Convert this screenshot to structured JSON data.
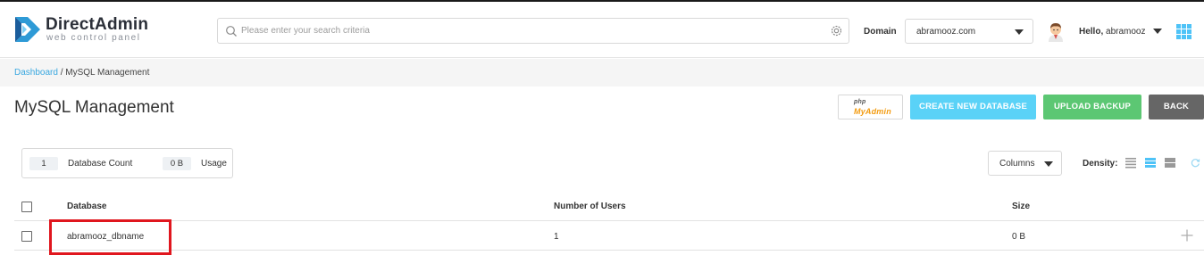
{
  "app": {
    "title": "DirectAdmin",
    "subtitle": "web control panel"
  },
  "header": {
    "search_placeholder": "Please enter your search criteria",
    "domain_label": "Domain",
    "domain_value": "abramooz.com",
    "hello_prefix": "Hello,",
    "username": "abramooz"
  },
  "breadcrumb": {
    "root": "Dashboard",
    "separator": " / ",
    "current": "MySQL Management"
  },
  "page": {
    "title": "MySQL Management"
  },
  "actions": {
    "phpmyadmin_php": "php",
    "phpmyadmin_my": "MyAdmin",
    "create_label": "CREATE NEW DATABASE",
    "upload_label": "UPLOAD BACKUP",
    "back_label": "BACK"
  },
  "stats": {
    "db_count": "1",
    "db_count_label": "Database Count",
    "usage": "0 B",
    "usage_label": "Usage"
  },
  "toolbar": {
    "columns_label": "Columns",
    "density_label": "Density:"
  },
  "table": {
    "headers": {
      "database": "Database",
      "users": "Number of Users",
      "size": "Size"
    },
    "rows": [
      {
        "database": "abramooz_dbname",
        "users": "1",
        "size": "0 B"
      }
    ]
  },
  "colors": {
    "accent": "#5ad2f7",
    "success": "#5cc773",
    "back": "#666666",
    "link": "#3aa8e0",
    "highlight": "#e0161e"
  },
  "icons": [
    "directadmin-logo-icon",
    "search-icon",
    "gear-icon",
    "chevron-down-icon",
    "avatar-icon",
    "apps-grid-icon",
    "density-compact-icon",
    "density-normal-icon",
    "density-comfortable-icon",
    "refresh-icon",
    "plus-icon"
  ]
}
